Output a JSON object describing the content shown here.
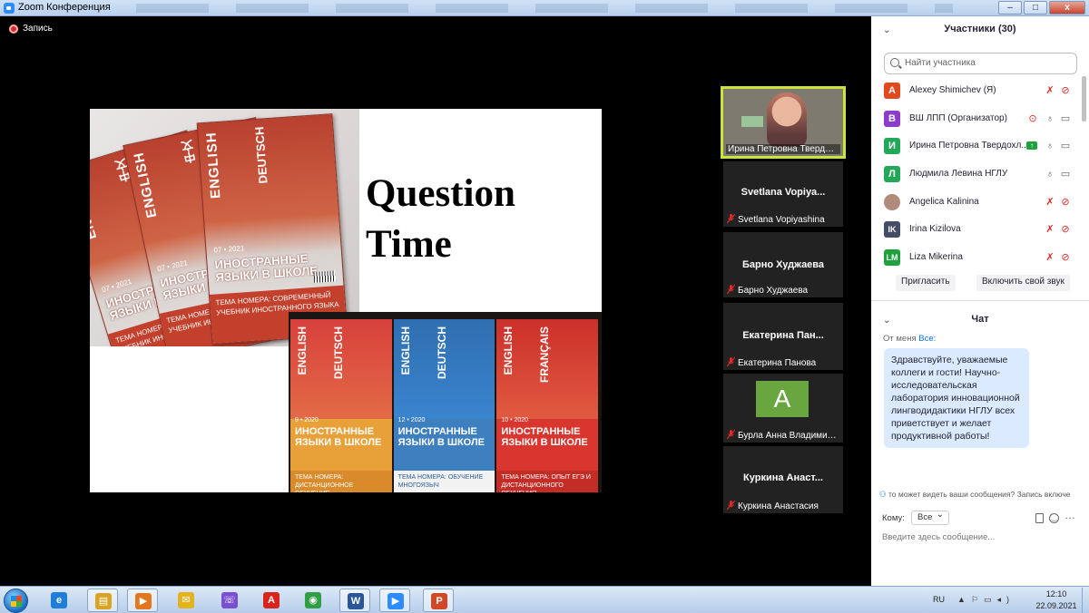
{
  "window": {
    "title": "Zoom Конференция",
    "minimize": "–",
    "maximize": "□",
    "close": "x"
  },
  "recording": {
    "label": "Запись"
  },
  "slide": {
    "heading_line1": "Question",
    "heading_line2": "Time",
    "magazines_top": [
      {
        "spine": "ENGLISH",
        "spine2": "中文",
        "date": "07 • 2021",
        "caption": "ИНОСТРАННЫЕ ЯЗЫКИ В ШКОЛЕ",
        "theme": "ТЕМА НОМЕРА: СОВРЕМЕННЫЙ УЧЕБНИК ИНОСТРАННОГО ЯЗЫКА"
      },
      {
        "spine": "ENGLISH",
        "spine2": "中文",
        "date": "07 • 2021",
        "caption": "ИНОСТРАННЫЕ ЯЗЫКИ В ШКОЛЕ",
        "theme": "ТЕМА НОМЕРА: СОВРЕМЕННЫЙ УЧЕБНИК ИНОСТРАННОГО ЯЗЫКА"
      },
      {
        "spine": "ENGLISH",
        "spine2": "DEUTSCH",
        "date": "07 • 2021",
        "caption": "ИНОСТРАННЫЕ ЯЗЫКИ В ШКОЛЕ",
        "theme": "ТЕМА НОМЕРА: СОВРЕМЕННЫЙ УЧЕБНИК ИНОСТРАННОГО ЯЗЫКА"
      }
    ],
    "magazines_bottom": [
      {
        "spine": "ENGLISH",
        "spine2": "DEUTSCH",
        "date": "9 • 2020",
        "caption": "ИНОСТРАННЫЕ ЯЗЫКИ В ШКОЛЕ",
        "theme": "ТЕМА НОМЕРА: ДИСТАНЦИОННОЕ ОБУЧЕНИЕ"
      },
      {
        "spine": "ENGLISH",
        "spine2": "DEUTSCH",
        "date": "12 • 2020",
        "caption": "ИНОСТРАННЫЕ ЯЗЫКИ В ШКОЛЕ",
        "theme": "ТЕМА НОМЕРА: ОБУЧЕНИЕ МНОГОЯЗЫЧ"
      },
      {
        "spine": "ENGLISH",
        "spine2": "FRANÇAIS",
        "date": "10 • 2020",
        "caption": "ИНОСТРАННЫЕ ЯЗЫКИ В ШКОЛЕ",
        "theme": "ТЕМА НОМЕРА: ОПЫТ ЕГЭ И ДИСТАНЦИОННОГО ОБУЧЕНИЯ"
      }
    ]
  },
  "videos": {
    "active": {
      "label": "Ирина Петровна Твердох..."
    },
    "tiles": [
      {
        "name": "Svetlana Vopiya...",
        "label": "Svetlana Vopiyashina"
      },
      {
        "name": "Барно Худжаева",
        "label": "Барно Худжаева"
      },
      {
        "name": "Екатерина Пан...",
        "label": "Екатерина Панова"
      },
      {
        "avatar": "A",
        "label": "Бурла Анна Владимиро..."
      },
      {
        "name": "Куркина Анаст...",
        "label": "Куркина Анастасия"
      }
    ]
  },
  "participants": {
    "title": "Участники (30)",
    "search_placeholder": "Найти участника",
    "list": [
      {
        "initial": "A",
        "color": "#e04a1c",
        "name": "Alexey Shimichev (Я)"
      },
      {
        "initial": "В",
        "color": "#8c3cc8",
        "name": "ВШ ЛПП (Организатор)"
      },
      {
        "initial": "И",
        "color": "#23a859",
        "name": "Ирина Петровна Твердохл..."
      },
      {
        "initial": "Л",
        "color": "#23a859",
        "name": "Людмила Левина НГЛУ"
      },
      {
        "initial": "",
        "color": "#b08a7a",
        "name": "Angelica Kalinina"
      },
      {
        "initial": "IK",
        "color": "#444d66",
        "name": "Irina Kizilova"
      },
      {
        "initial": "LM",
        "color": "#1fa23c",
        "name": "Liza Mikerina"
      }
    ],
    "invite_button": "Пригласить",
    "unmute_button": "Включить свой звук"
  },
  "chat": {
    "title": "Чат",
    "from_prefix": "От меня",
    "from_target": "Все:",
    "message": "Здравствуйте, уважаемые коллеги и гости! Научно-исследовательская лаборатория инновационной лингводидактики НГЛУ всех приветствует и желает продуктивной работы!",
    "who_can_see": "то может видеть ваши сообщения? Запись включе",
    "to_label": "Кому:",
    "to_value": "Все",
    "input_placeholder": "Введите здесь сообщение..."
  },
  "taskbar": {
    "lang": "RU",
    "time": "12:10",
    "date": "22.09.2021",
    "apps": [
      {
        "name": "ie",
        "glyph": "e",
        "color": "#1f7fd8"
      },
      {
        "name": "explorer",
        "glyph": "▤",
        "color": "#d9a423"
      },
      {
        "name": "media",
        "glyph": "▶",
        "color": "#e2771f"
      },
      {
        "name": "mail",
        "glyph": "✉",
        "color": "#e3b21f"
      },
      {
        "name": "viber",
        "glyph": "☏",
        "color": "#7a4fd0"
      },
      {
        "name": "acrobat",
        "glyph": "A",
        "color": "#d8241c"
      },
      {
        "name": "chrome",
        "glyph": "◉",
        "color": "#2f9e44"
      },
      {
        "name": "word",
        "glyph": "W",
        "color": "#2b579a"
      },
      {
        "name": "zoom",
        "glyph": "▶",
        "color": "#2d8cff"
      },
      {
        "name": "present",
        "glyph": "P",
        "color": "#d24726"
      }
    ]
  }
}
